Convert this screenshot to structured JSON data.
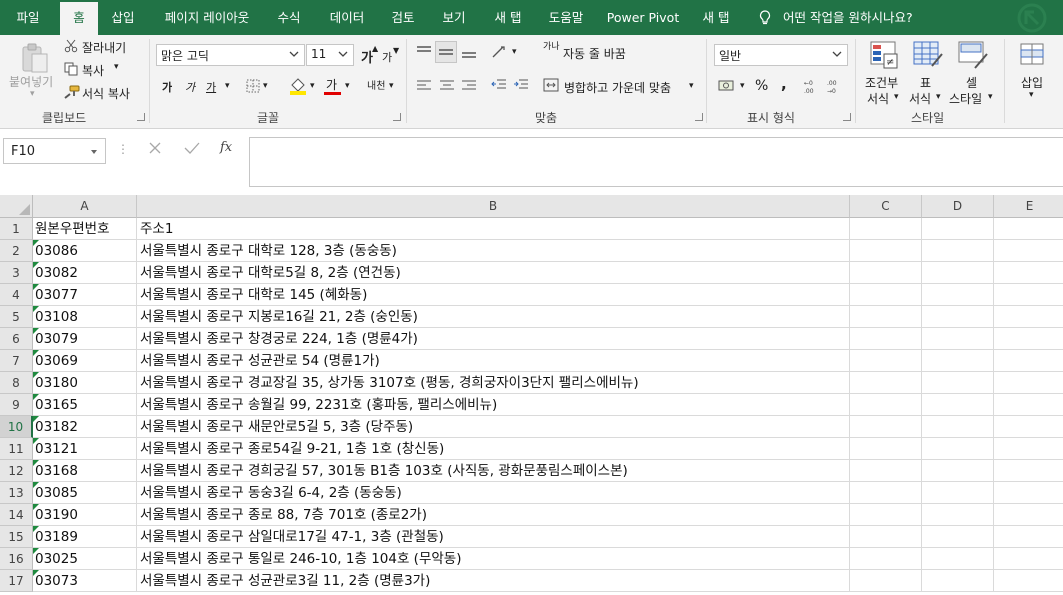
{
  "tabs": [
    {
      "label": "파일",
      "active": false
    },
    {
      "label": "홈",
      "active": true
    },
    {
      "label": "삽입",
      "active": false
    },
    {
      "label": "페이지 레이아웃",
      "active": false
    },
    {
      "label": "수식",
      "active": false
    },
    {
      "label": "데이터",
      "active": false
    },
    {
      "label": "검토",
      "active": false
    },
    {
      "label": "보기",
      "active": false
    },
    {
      "label": "새 탭",
      "active": false
    },
    {
      "label": "도움말",
      "active": false
    },
    {
      "label": "Power Pivot",
      "active": false
    },
    {
      "label": "새 탭",
      "active": false
    }
  ],
  "tell_me": "어떤 작업을 원하시나요?",
  "colors": {
    "accent": "#217346",
    "ribbon_bg": "#f3f3f3",
    "error_triangle": "#1f8a3f"
  },
  "ribbon": {
    "clipboard": {
      "paste": "붙여넣기",
      "cut": "잘라내기",
      "copy": "복사",
      "format_painter": "서식 복사",
      "label": "클립보드"
    },
    "font": {
      "font_name": "맑은 고딕",
      "font_size": "11",
      "bold": "가",
      "italic": "가",
      "underline": "가",
      "font_color_glyph": "가",
      "phonetic": "내천",
      "grow": "가",
      "shrink": "가",
      "label": "글꼴"
    },
    "alignment": {
      "wrap_text": "자동 줄 바꿈",
      "merge_center": "병합하고 가운데 맞춤",
      "wrap_glyph": "가나",
      "label": "맞춤"
    },
    "number": {
      "format": "일반",
      "percent": "%",
      "comma": ",",
      "label": "표시 형식"
    },
    "styles": {
      "conditional": "조건부",
      "conditional_sub": "서식",
      "table": "표",
      "table_sub": "서식",
      "cell": "셀",
      "cell_sub": "스타일",
      "label": "스타일"
    },
    "cells": {
      "insert": "삽입"
    }
  },
  "formula_bar": {
    "name_box": "F10",
    "fx": "fx",
    "value": ""
  },
  "columns": [
    "A",
    "B",
    "C",
    "D",
    "E"
  ],
  "selected_row": "10",
  "rows": [
    {
      "num": "1",
      "a": "원본우편번호",
      "b": "주소1",
      "tri": false
    },
    {
      "num": "2",
      "a": "03086",
      "b": "서울특별시 종로구 대학로 128, 3층 (동숭동)",
      "tri": true
    },
    {
      "num": "3",
      "a": "03082",
      "b": "서울특별시 종로구 대학로5길 8, 2층 (연건동)",
      "tri": true
    },
    {
      "num": "4",
      "a": "03077",
      "b": "서울특별시 종로구 대학로 145 (혜화동)",
      "tri": true
    },
    {
      "num": "5",
      "a": "03108",
      "b": "서울특별시 종로구 지봉로16길 21, 2층 (숭인동)",
      "tri": true
    },
    {
      "num": "6",
      "a": "03079",
      "b": "서울특별시 종로구 창경궁로 224, 1층 (명륜4가)",
      "tri": true
    },
    {
      "num": "7",
      "a": "03069",
      "b": "서울특별시 종로구 성균관로 54 (명륜1가)",
      "tri": true
    },
    {
      "num": "8",
      "a": "03180",
      "b": "서울특별시 종로구 경교장길 35, 상가동 3107호 (평동, 경희궁자이3단지 팰리스에비뉴)",
      "tri": true
    },
    {
      "num": "9",
      "a": "03165",
      "b": "서울특별시 종로구 송월길 99, 2231호 (홍파동, 팰리스에비뉴)",
      "tri": true
    },
    {
      "num": "10",
      "a": "03182",
      "b": "서울특별시 종로구 새문안로5길 5, 3층 (당주동)",
      "tri": true
    },
    {
      "num": "11",
      "a": "03121",
      "b": "서울특별시 종로구 종로54길 9-21, 1층 1호 (창신동)",
      "tri": true
    },
    {
      "num": "12",
      "a": "03168",
      "b": "서울특별시 종로구 경희궁길 57, 301동 B1층 103호 (사직동, 광화문풍림스페이스본)",
      "tri": true
    },
    {
      "num": "13",
      "a": "03085",
      "b": "서울특별시 종로구 동숭3길 6-4, 2층 (동숭동)",
      "tri": true
    },
    {
      "num": "14",
      "a": "03190",
      "b": "서울특별시 종로구 종로 88, 7층 701호 (종로2가)",
      "tri": true
    },
    {
      "num": "15",
      "a": "03189",
      "b": "서울특별시 종로구 삼일대로17길 47-1, 3층 (관철동)",
      "tri": true
    },
    {
      "num": "16",
      "a": "03025",
      "b": "서울특별시 종로구 통일로 246-10, 1층 104호 (무악동)",
      "tri": true
    },
    {
      "num": "17",
      "a": "03073",
      "b": "서울특별시 종로구 성균관로3길 11, 2층 (명륜3가)",
      "tri": true
    }
  ]
}
